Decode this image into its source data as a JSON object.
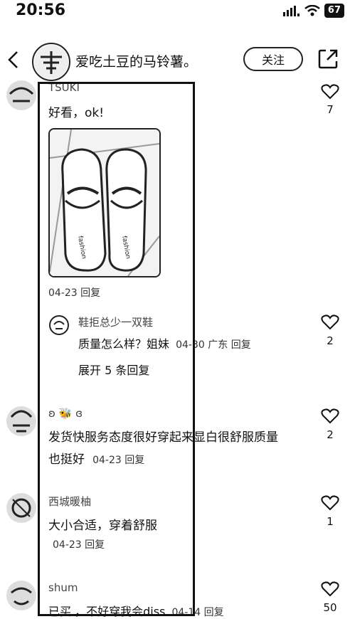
{
  "status": {
    "time": "20:56",
    "battery": "67"
  },
  "header": {
    "title": "爱吃土豆的马铃薯。",
    "follow_label": "关注"
  },
  "comments": [
    {
      "username": "TSUKI",
      "text": "好看，ok!",
      "meta": "04-23 回复",
      "likes": "7",
      "replies": [
        {
          "username": "鞋拒总少一双鞋",
          "text": "质量怎么样？姐妹",
          "meta": "04-30 广东 回复",
          "likes": "2"
        }
      ],
      "expand_label": "展开 5 条回复"
    },
    {
      "username": "ʚ 🐝 ɞ",
      "text_line1": "发货快服务态度很好穿起来显白很舒服质量",
      "text_line2": "也挺好",
      "meta": "04-23 回复",
      "likes": "2"
    },
    {
      "username": "西城暖柚",
      "text": "大小合适，穿着舒服",
      "meta": "04-23 回复",
      "likes": "1"
    },
    {
      "username": "shum",
      "text": "已买 ，不好穿我会diss",
      "meta": "04-14 回复",
      "likes": "50"
    }
  ]
}
